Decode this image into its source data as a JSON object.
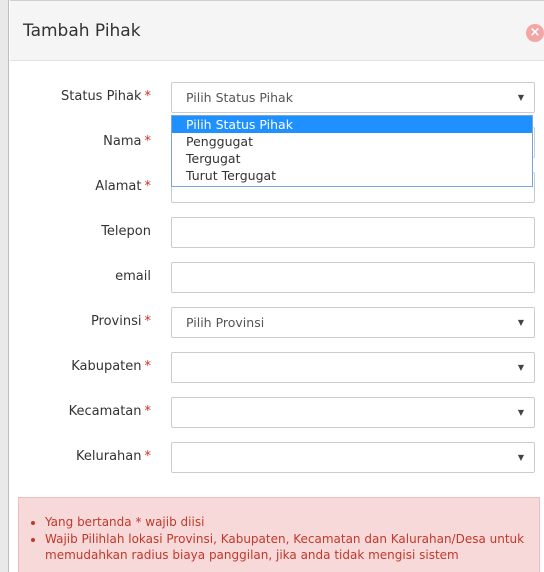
{
  "modal": {
    "title": "Tambah Pihak",
    "close_glyph": "×"
  },
  "form": {
    "required_mark": "*",
    "status_pihak": {
      "label": "Status Pihak",
      "value": "Pilih Status Pihak"
    },
    "nama": {
      "label": "Nama"
    },
    "alamat": {
      "label": "Alamat"
    },
    "telepon": {
      "label": "Telepon"
    },
    "email": {
      "label": "email"
    },
    "provinsi": {
      "label": "Provinsi",
      "value": "Pilih Provinsi"
    },
    "kabupaten": {
      "label": "Kabupaten",
      "value": ""
    },
    "kecamatan": {
      "label": "Kecamatan",
      "value": ""
    },
    "kelurahan": {
      "label": "Kelurahan",
      "value": ""
    }
  },
  "dropdown": {
    "options": [
      "Pilih Status Pihak",
      "Penggugat",
      "Tergugat",
      "Turut Tergugat"
    ],
    "selected_index": 0
  },
  "alert": {
    "items": [
      "Yang bertanda * wajib diisi",
      "Wajib Pilihlah lokasi Provinsi, Kabupaten, Kecamatan dan Kalurahan/Desa untuk memudahkan radius biaya panggilan, jika anda tidak mengisi sistem"
    ]
  },
  "colors": {
    "accent": "#1e90ff",
    "required": "#d9281c",
    "alert_bg": "#f8d9da",
    "alert_text": "#c0392b"
  },
  "icons": {
    "close": "close-icon",
    "caret": "chevron-down-icon"
  }
}
